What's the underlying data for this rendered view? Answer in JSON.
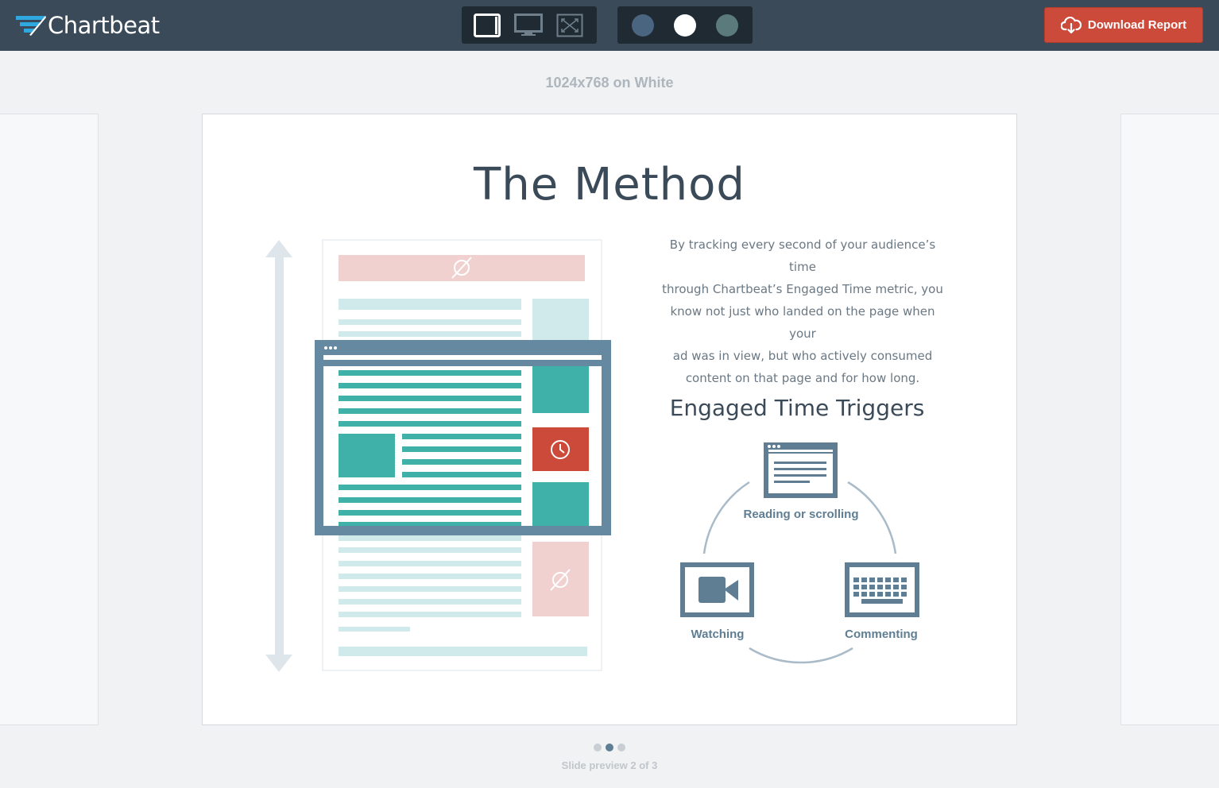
{
  "brand": {
    "name": "Chartbeat"
  },
  "toolbar": {
    "device_options": [
      "tablet",
      "desktop",
      "fullscreen"
    ],
    "selected_device": "tablet",
    "theme_swatches": [
      {
        "name": "dark-blue",
        "color": "#4a6580"
      },
      {
        "name": "white",
        "color": "#ffffff"
      },
      {
        "name": "slate-green",
        "color": "#5b7a7c"
      }
    ],
    "selected_theme": "white",
    "download_label": "Download Report"
  },
  "preview": {
    "size_label": "1024x768 on White",
    "status": "Slide preview 2 of 3",
    "current_slide": 2,
    "total_slides": 3
  },
  "slide": {
    "title": "The Method",
    "body": "By tracking every second of your audience’s time through Chartbeat’s Engaged Time metric, you know not just who landed on the page when your ad was in view, but who actively consumed content on that page and for how long.",
    "body_lines": [
      "By tracking every second of your audience’s time",
      "through Chartbeat’s Engaged Time metric, you",
      "know not just who landed on the page when your",
      "ad was in view, but who actively consumed",
      "content on that page and for how long."
    ],
    "triggers_title": "Engaged Time Triggers",
    "triggers": [
      {
        "label": "Reading or scrolling",
        "icon": "browser-window-icon"
      },
      {
        "label": "Watching",
        "icon": "video-camera-icon"
      },
      {
        "label": "Commenting",
        "icon": "keyboard-icon"
      }
    ]
  },
  "colors": {
    "topbar": "#3a4a58",
    "accent_red": "#cc4a39",
    "teal": "#40b1a9",
    "frame": "#6589a0",
    "ad_pink": "#f1d1d0",
    "light_teal": "#d0e9ea"
  }
}
